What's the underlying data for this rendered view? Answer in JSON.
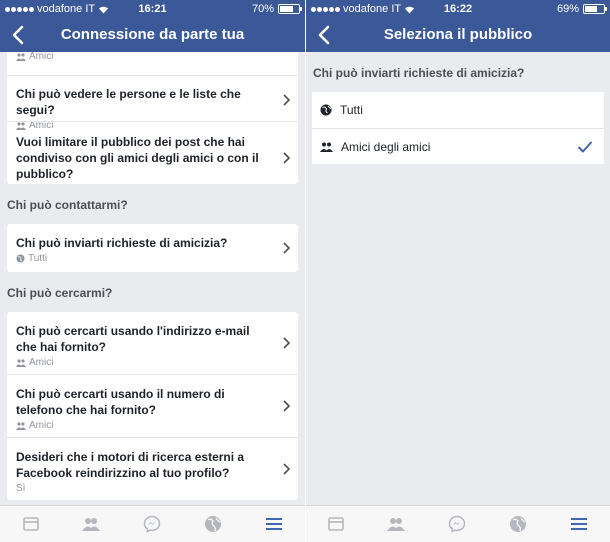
{
  "left": {
    "status": {
      "carrier": "vodafone IT",
      "time": "16:21",
      "battery": "70%",
      "battery_level": 0.7
    },
    "nav_title": "Connessione da parte tua",
    "top_card": [
      {
        "question": "",
        "audience": "Amici",
        "audience_icon": "friends-icon"
      },
      {
        "question": "Chi può vedere le persone e le liste che segui?",
        "audience": "Amici",
        "audience_icon": "friends-icon"
      },
      {
        "question": "Vuoi limitare il pubblico dei post che hai condiviso con gli amici degli amici o con il pubblico?",
        "audience": ""
      }
    ],
    "section_contact": "Chi può contattarmi?",
    "contact_card": [
      {
        "question": "Chi può inviarti richieste di amicizia?",
        "audience": "Tutti",
        "audience_icon": "globe-icon"
      }
    ],
    "section_search": "Chi può cercarmi?",
    "search_card": [
      {
        "question": "Chi può cercarti usando l'indirizzo e-mail che hai fornito?",
        "audience": "Amici",
        "audience_icon": "friends-icon"
      },
      {
        "question": "Chi può cercarti usando il numero di telefono che hai fornito?",
        "audience": "Amici",
        "audience_icon": "friends-icon"
      },
      {
        "question": "Desideri che i motori di ricerca esterni a Facebook reindirizzino al tuo profilo?",
        "audience": "Sì"
      }
    ]
  },
  "right": {
    "status": {
      "carrier": "vodafone IT",
      "time": "16:22",
      "battery": "69%",
      "battery_level": 0.69
    },
    "nav_title": "Seleziona il pubblico",
    "question": "Chi può inviarti richieste di amicizia?",
    "options": [
      {
        "label": "Tutti",
        "icon": "globe-icon",
        "selected": false
      },
      {
        "label": "Amici degli amici",
        "icon": "friends-icon",
        "selected": true
      }
    ]
  },
  "tabs": [
    "news-feed-icon",
    "friends-tab-icon",
    "messenger-icon",
    "notifications-globe-icon",
    "menu-icon"
  ],
  "colors": {
    "brand": "#3b5998",
    "background": "#e9ebee",
    "active_tab": "#4267b2",
    "inactive_tab": "#b4b7bd",
    "check": "#4267b2"
  }
}
